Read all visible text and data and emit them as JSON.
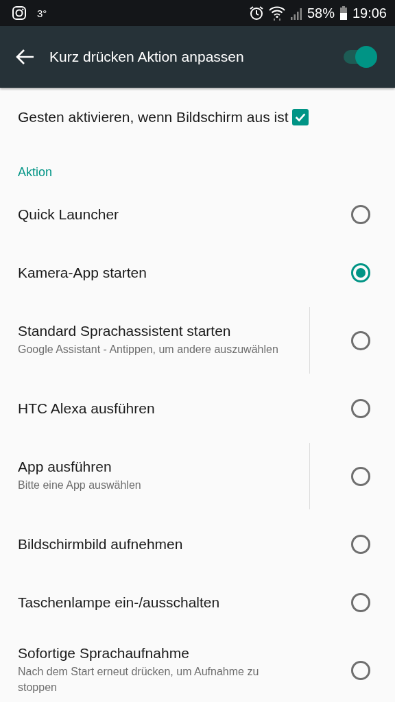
{
  "status_bar": {
    "temperature": "3°",
    "battery": "58%",
    "time": "19:06"
  },
  "app_bar": {
    "title": "Kurz drücken Aktion anpassen",
    "toggle_on": true
  },
  "gesture_option": {
    "label": "Gesten aktivieren, wenn Bildschirm aus ist",
    "checked": true
  },
  "section": {
    "title": "Aktion"
  },
  "options": [
    {
      "label": "Quick Launcher",
      "selected": false,
      "has_settings": false
    },
    {
      "label": "Kamera-App starten",
      "selected": true,
      "has_settings": false
    },
    {
      "label": "Standard Sprachassistent starten",
      "summary": "Google  Assistant - Antippen, um andere auszuwählen",
      "selected": false,
      "has_settings": true
    },
    {
      "label": "HTC Alexa ausführen",
      "selected": false,
      "has_settings": false
    },
    {
      "label": "App ausführen",
      "summary": "Bitte eine App auswählen",
      "selected": false,
      "has_settings": true
    },
    {
      "label": "Bildschirmbild aufnehmen",
      "selected": false,
      "has_settings": false
    },
    {
      "label": "Taschenlampe ein-/ausschalten",
      "selected": false,
      "has_settings": false
    },
    {
      "label": "Sofortige Sprachaufnahme",
      "summary": "Nach dem Start erneut drücken, um Aufnahme zu stoppen",
      "selected": false,
      "has_settings": false
    }
  ]
}
